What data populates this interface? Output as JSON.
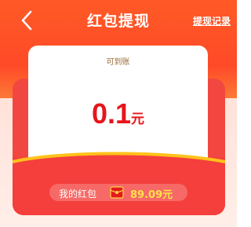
{
  "header": {
    "title": "红包提现",
    "records_link": "提现记录",
    "back_icon": "chevron-left-icon"
  },
  "card": {
    "label": "可到账",
    "amount": "0.1",
    "unit": "元"
  },
  "wallet": {
    "label": "我的红包",
    "icon": "red-envelope-icon",
    "amount": "89.09元"
  },
  "colors": {
    "header_red": "#ff4a28",
    "envelope_red": "#f24741",
    "amount_red": "#e5161b",
    "gold": "#ffe14a",
    "label_brown": "#9a6a3a"
  }
}
